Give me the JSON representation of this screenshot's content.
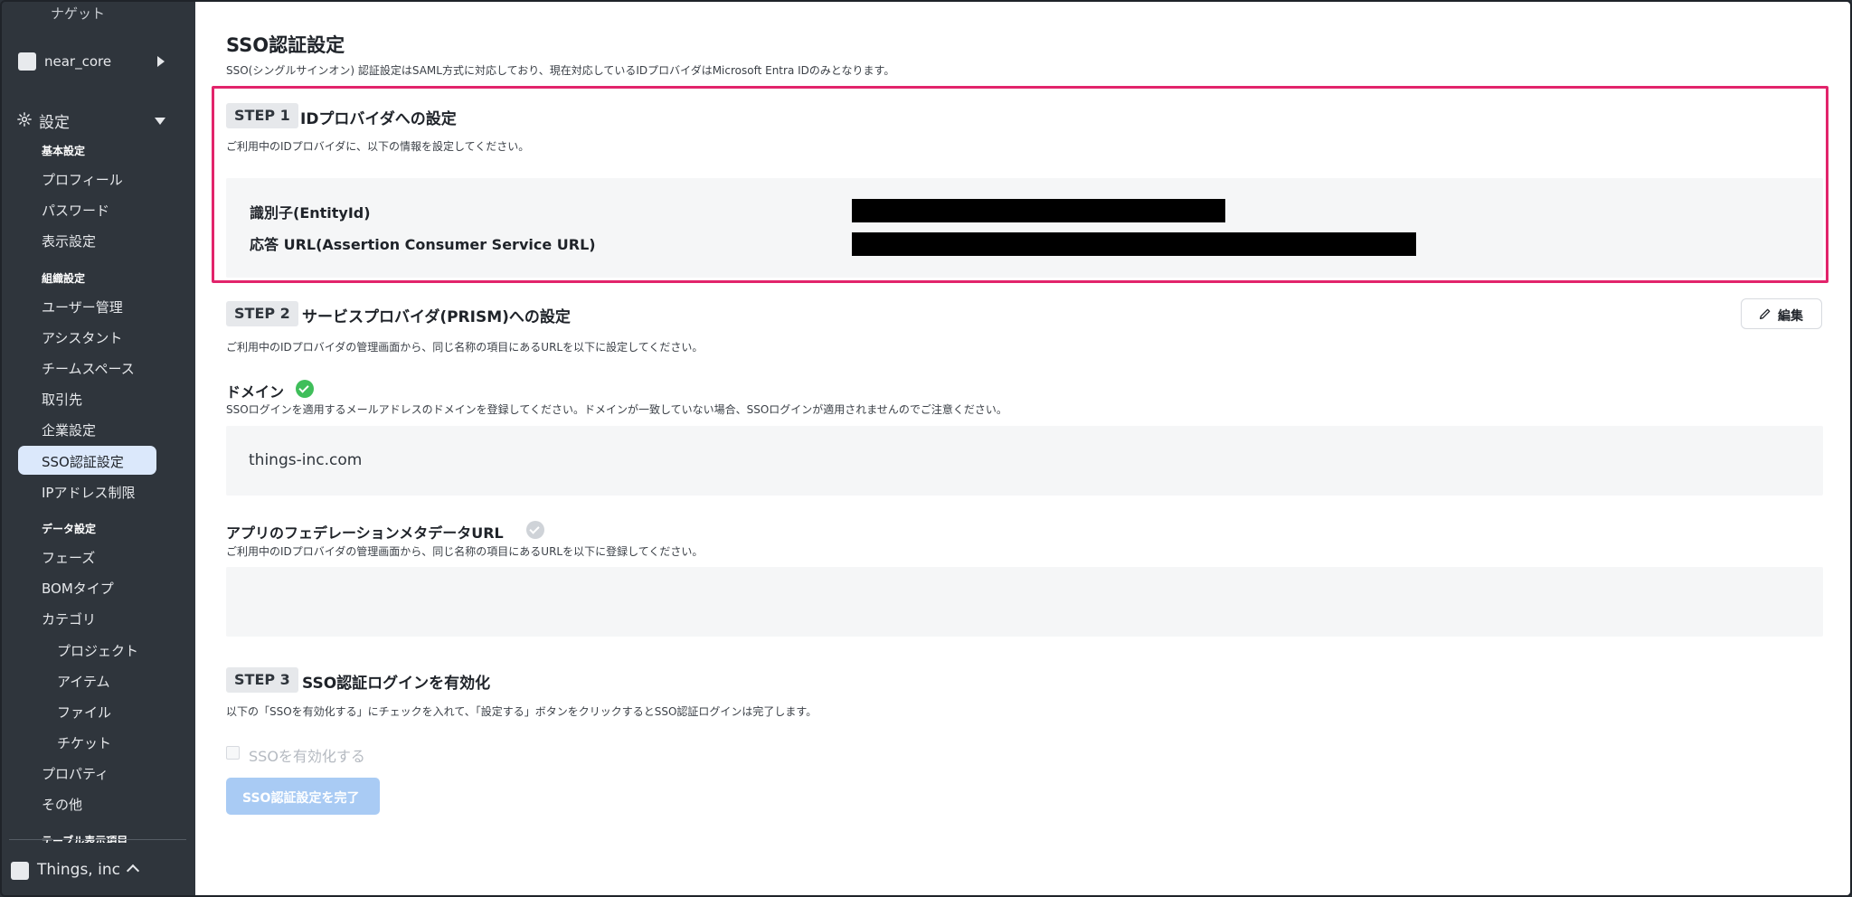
{
  "sidebar": {
    "top_partial": "ナゲット",
    "workspace": "near_core",
    "settings": "設定",
    "sections": {
      "basic": "基本設定",
      "org": "組織設定",
      "data": "データ設定",
      "table_partial": "テーブル表示項目"
    },
    "items_basic": [
      "プロフィール",
      "パスワード",
      "表示設定"
    ],
    "items_org": [
      "ユーザー管理",
      "アシスタント",
      "チームスペース",
      "取引先",
      "企業設定",
      "SSO認証設定",
      "IPアドレス制限"
    ],
    "items_data": [
      "フェーズ",
      "BOMタイプ",
      "カテゴリ"
    ],
    "items_category": [
      "プロジェクト",
      "アイテム",
      "ファイル",
      "チケット"
    ],
    "items_data_more": [
      "プロパティ",
      "その他"
    ],
    "org_name": "Things, inc"
  },
  "main": {
    "title": "SSO認証設定",
    "description": "SSO(シングルサインオン) 認証設定はSAML方式に対応しており、現在対応しているIDプロバイダはMicrosoft Entra IDのみとなります。",
    "step1": {
      "badge": "STEP 1",
      "title": "IDプロバイダへの設定",
      "desc": "ご利用中のIDプロバイダに、以下の情報を設定してください。",
      "entity_label": "識別子(EntityId)",
      "acs_label": "応答 URL(Assertion Consumer Service URL)"
    },
    "step2": {
      "badge": "STEP 2",
      "title": "サービスプロバイダ(PRISM)への設定",
      "desc": "ご利用中のIDプロバイダの管理画面から、同じ名称の項目にあるURLを以下に設定してください。",
      "edit_label": "編集",
      "domain_label": "ドメイン",
      "domain_desc": "SSOログインを適用するメールアドレスのドメインを登録してください。ドメインが一致していない場合、SSOログインが適用されませんのでご注意ください。",
      "domain_value": "things-inc.com",
      "metadata_label": "アプリのフェデレーションメタデータURL",
      "metadata_desc": "ご利用中のIDプロバイダの管理画面から、同じ名称の項目にあるURLを以下に登録してください。",
      "metadata_value": ""
    },
    "step3": {
      "badge": "STEP 3",
      "title": "SSO認証ログインを有効化",
      "desc": "以下の「SSOを有効化する」にチェックを入れて、「設定する」ボタンをクリックするとSSO認証ログインは完了します。",
      "checkbox_label": "SSOを有効化する",
      "submit_label": "SSO認証設定を完了"
    }
  }
}
